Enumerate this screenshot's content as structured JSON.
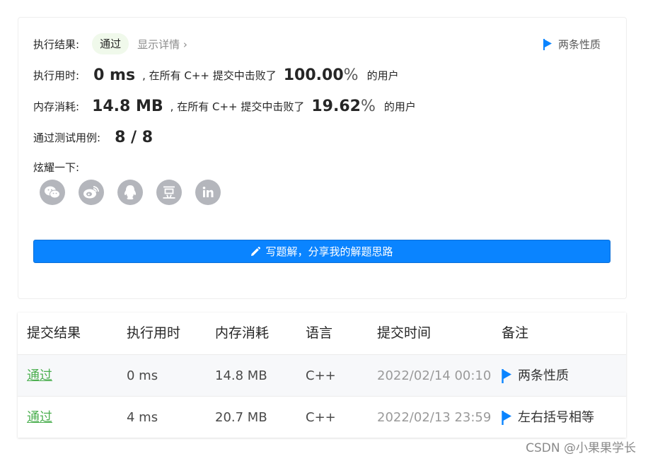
{
  "result": {
    "label": "执行结果:",
    "status": "通过",
    "details_link": "显示详情 ›",
    "note": "两条性质"
  },
  "runtime": {
    "label": "执行用时:",
    "value": "0 ms",
    "beat_text": ", 在所有 C++ 提交中击败了",
    "percent": "100.00",
    "percent_sign": "%",
    "suffix": "的用户"
  },
  "memory": {
    "label": "内存消耗:",
    "value": "14.8 MB",
    "beat_text": ", 在所有 C++ 提交中击败了",
    "percent": "19.62",
    "percent_sign": "%",
    "suffix": "的用户"
  },
  "testcases": {
    "label": "通过测试用例:",
    "value": "8 / 8"
  },
  "share": {
    "label": "炫耀一下:",
    "icons": [
      "wechat-icon",
      "weibo-icon",
      "qq-icon",
      "douban-icon",
      "linkedin-icon"
    ]
  },
  "write_solution_button": "写题解，分享我的解题思路",
  "submissions": {
    "headers": [
      "提交结果",
      "执行用时",
      "内存消耗",
      "语言",
      "提交时间",
      "备注"
    ],
    "rows": [
      {
        "status": "通过",
        "runtime": "0 ms",
        "memory": "14.8 MB",
        "language": "C++",
        "time": "2022/02/14 00:10",
        "note": "两条性质"
      },
      {
        "status": "通过",
        "runtime": "4 ms",
        "memory": "20.7 MB",
        "language": "C++",
        "time": "2022/02/13 23:59",
        "note": "左右括号相等"
      }
    ]
  },
  "watermark": "CSDN @小果果学长",
  "colors": {
    "accent": "#0a84ff",
    "success": "#4caf50",
    "pill_bg": "#f0f9eb",
    "share_icon_bg": "#b4b6bc"
  }
}
